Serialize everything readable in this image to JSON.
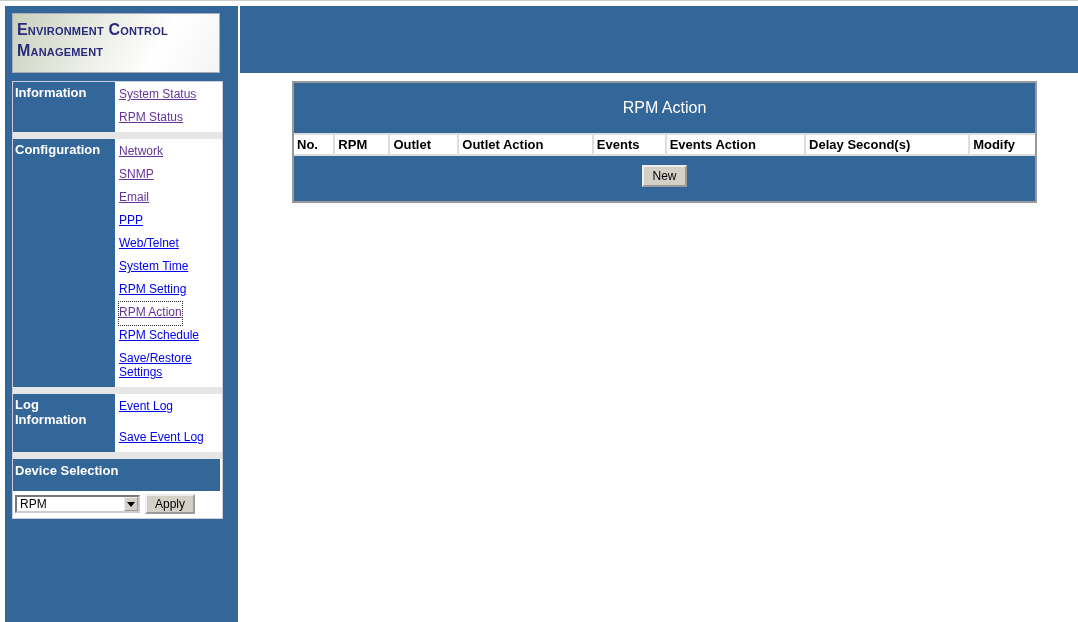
{
  "logo": {
    "line_1": "Environment Control",
    "line_2": "Management"
  },
  "nav_sections": [
    {
      "title": "Information",
      "links": [
        {
          "label": "System Status",
          "visited": true,
          "selected": false
        },
        {
          "label": "RPM Status",
          "visited": true,
          "selected": false
        }
      ]
    },
    {
      "title": "Configuration",
      "links": [
        {
          "label": "Network",
          "visited": true,
          "selected": false
        },
        {
          "label": "SNMP",
          "visited": true,
          "selected": false
        },
        {
          "label": "Email",
          "visited": true,
          "selected": false
        },
        {
          "label": "PPP",
          "visited": false,
          "selected": false
        },
        {
          "label": "Web/Telnet",
          "visited": false,
          "selected": false
        },
        {
          "label": "System Time",
          "visited": false,
          "selected": false
        },
        {
          "label": "RPM Setting",
          "visited": false,
          "selected": false
        },
        {
          "label": "RPM Action",
          "visited": true,
          "selected": true
        },
        {
          "label": "RPM Schedule",
          "visited": false,
          "selected": false
        },
        {
          "label": "Save/Restore Settings",
          "visited": false,
          "selected": false
        }
      ]
    },
    {
      "title": "Log Information",
      "links": [
        {
          "label": "Event Log",
          "visited": false,
          "selected": false
        },
        {
          "label": "Save Event Log",
          "visited": false,
          "selected": false
        }
      ]
    }
  ],
  "device_selection": {
    "title": "Device Selection",
    "value": "RPM",
    "button": "Apply"
  },
  "table": {
    "title": "RPM Action",
    "columns": [
      "No.",
      "RPM",
      "Outlet",
      "Outlet Action",
      "Events",
      "Events Action",
      "Delay Second(s)",
      "Modify"
    ],
    "button": "New"
  }
}
